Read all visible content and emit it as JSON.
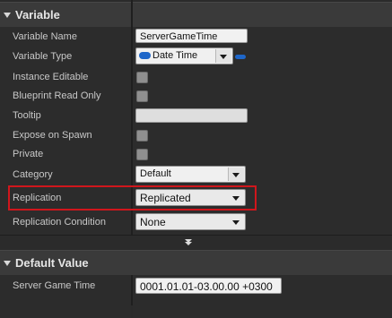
{
  "variable_section": {
    "title": "Variable",
    "rows": {
      "variable_name": {
        "label": "Variable Name",
        "value": "ServerGameTime"
      },
      "variable_type": {
        "label": "Variable Type",
        "value": "Date Time"
      },
      "instance_editable": {
        "label": "Instance Editable"
      },
      "blueprint_read_only": {
        "label": "Blueprint Read Only"
      },
      "tooltip": {
        "label": "Tooltip",
        "value": ""
      },
      "expose_on_spawn": {
        "label": "Expose on Spawn"
      },
      "private": {
        "label": "Private"
      },
      "category": {
        "label": "Category",
        "value": "Default"
      },
      "replication": {
        "label": "Replication",
        "value": "Replicated"
      },
      "replication_condition": {
        "label": "Replication Condition",
        "value": "None"
      }
    }
  },
  "default_value_section": {
    "title": "Default Value",
    "rows": {
      "server_game_time": {
        "label": "Server Game Time",
        "value": "0001.01.01-03.00.00 +0300"
      }
    }
  },
  "colors": {
    "highlight_border": "#d0161c",
    "type_pill": "#1e66c9"
  },
  "icons": [
    "collapse-arrow-icon",
    "advanced-expander-icon",
    "dropdown-arrow-icon",
    "type-pill-icon"
  ]
}
